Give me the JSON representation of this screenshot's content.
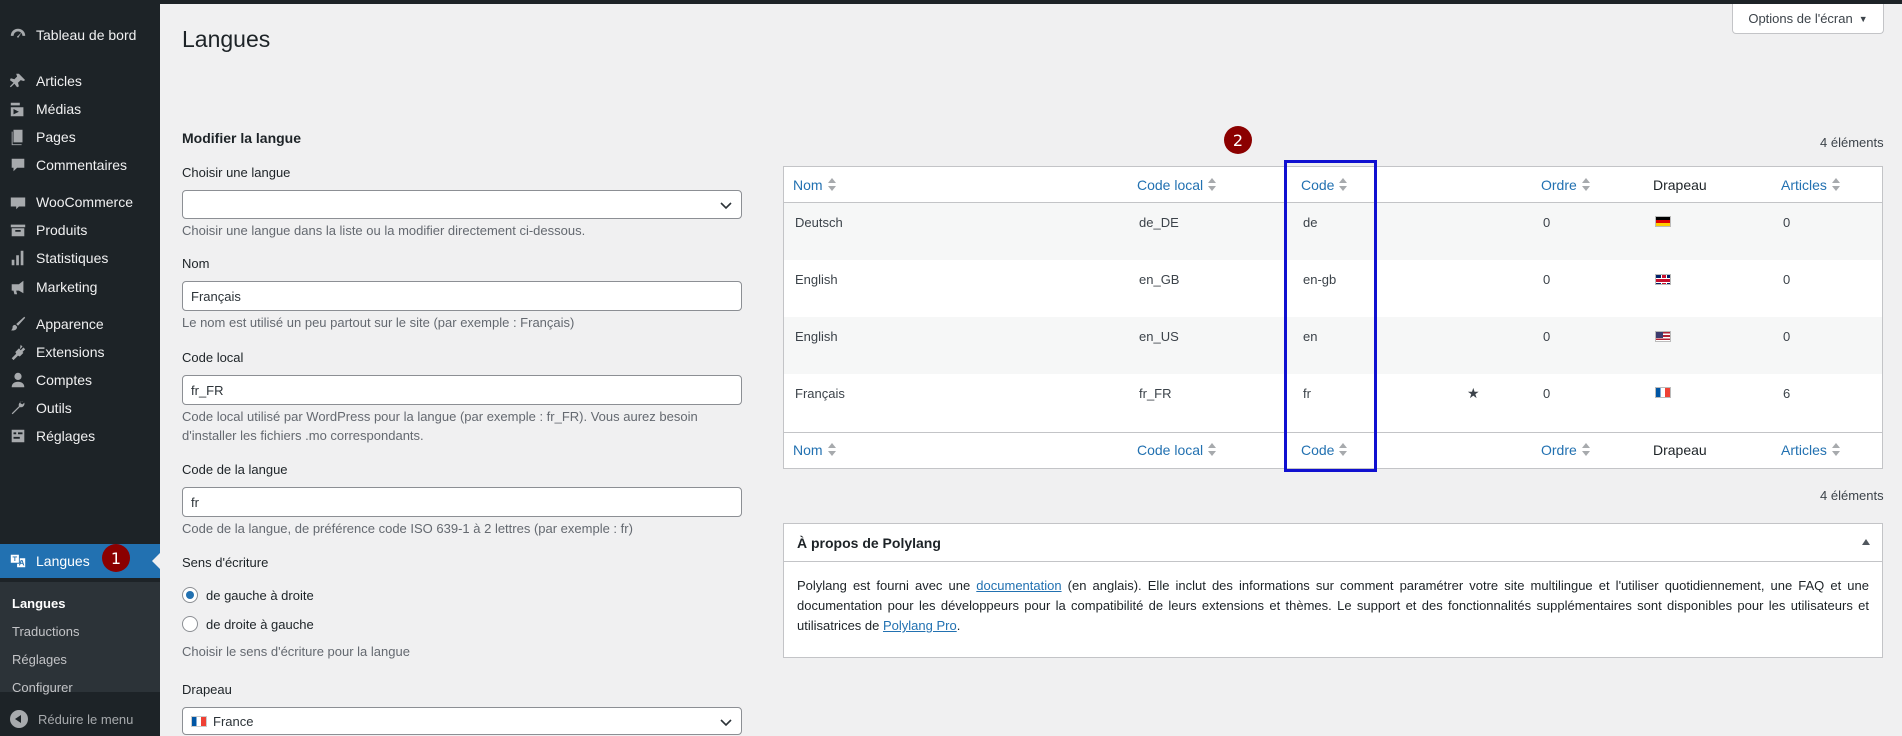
{
  "sidebar": {
    "items": [
      {
        "label": "Tableau de bord",
        "icon": "dashboard-icon"
      },
      {
        "label": "Articles",
        "icon": "pin-icon"
      },
      {
        "label": "Médias",
        "icon": "media-icon"
      },
      {
        "label": "Pages",
        "icon": "pages-icon"
      },
      {
        "label": "Commentaires",
        "icon": "comments-icon"
      },
      {
        "label": "WooCommerce",
        "icon": "woocommerce-icon"
      },
      {
        "label": "Produits",
        "icon": "products-icon"
      },
      {
        "label": "Statistiques",
        "icon": "stats-icon"
      },
      {
        "label": "Marketing",
        "icon": "megaphone-icon"
      },
      {
        "label": "Apparence",
        "icon": "brush-icon"
      },
      {
        "label": "Extensions",
        "icon": "plugin-icon"
      },
      {
        "label": "Comptes",
        "icon": "user-icon"
      },
      {
        "label": "Outils",
        "icon": "wrench-icon"
      },
      {
        "label": "Réglages",
        "icon": "settings-icon"
      },
      {
        "label": "Langues",
        "icon": "translate-icon"
      }
    ],
    "submenu": [
      "Langues",
      "Traductions",
      "Réglages",
      "Configurer"
    ],
    "collapse_label": "Réduire le menu"
  },
  "annotations": {
    "badge1": "1",
    "badge2": "2"
  },
  "screen_options": "Options de l'écran",
  "page_title": "Langues",
  "form": {
    "heading": "Modifier la langue",
    "choose_label": "Choisir une langue",
    "choose_value": "",
    "choose_help": "Choisir une langue dans la liste ou la modifier directement ci-dessous.",
    "name_label": "Nom",
    "name_value": "Français",
    "name_help": "Le nom est utilisé un peu partout sur le site (par exemple : Français)",
    "locale_label": "Code local",
    "locale_value": "fr_FR",
    "locale_help": "Code local utilisé par WordPress pour la langue (par exemple : fr_FR). Vous aurez besoin d'installer les fichiers .mo correspondants.",
    "code_label": "Code de la langue",
    "code_value": "fr",
    "code_help": "Code de la langue, de préférence code ISO 639-1 à 2 lettres (par exemple : fr)",
    "direction_label": "Sens d'écriture",
    "ltr_label": "de gauche à droite",
    "rtl_label": "de droite à gauche",
    "direction_help": "Choisir le sens d'écriture pour la langue",
    "flag_label": "Drapeau",
    "flag_value": "France"
  },
  "table": {
    "count_label": "4 éléments",
    "columns": [
      "Nom",
      "Code local",
      "Code",
      "Ordre",
      "Drapeau",
      "Articles"
    ],
    "rows": [
      {
        "name": "Deutsch",
        "locale": "de_DE",
        "code": "de",
        "default": "",
        "order": "0",
        "flag": "de",
        "posts": "0"
      },
      {
        "name": "English",
        "locale": "en_GB",
        "code": "en-gb",
        "default": "",
        "order": "0",
        "flag": "gb",
        "posts": "0"
      },
      {
        "name": "English",
        "locale": "en_US",
        "code": "en",
        "default": "",
        "order": "0",
        "flag": "us",
        "posts": "0"
      },
      {
        "name": "Français",
        "locale": "fr_FR",
        "code": "fr",
        "default": "★",
        "order": "0",
        "flag": "fr",
        "posts": "6"
      }
    ]
  },
  "about": {
    "title": "À propos de Polylang",
    "text_1": "Polylang est fourni avec une ",
    "link_doc": "documentation",
    "text_2": " (en anglais). Elle inclut des informations sur comment paramétrer votre site multilingue et l'utiliser quotidiennement, une FAQ et une documentation pour les développeurs pour la compatibilité de leurs extensions et thèmes. Le support et des fonctionnalités supplémentaires sont disponibles pour les utilisateurs et utilisatrices de ",
    "link_pro": "Polylang Pro",
    "text_3": "."
  }
}
